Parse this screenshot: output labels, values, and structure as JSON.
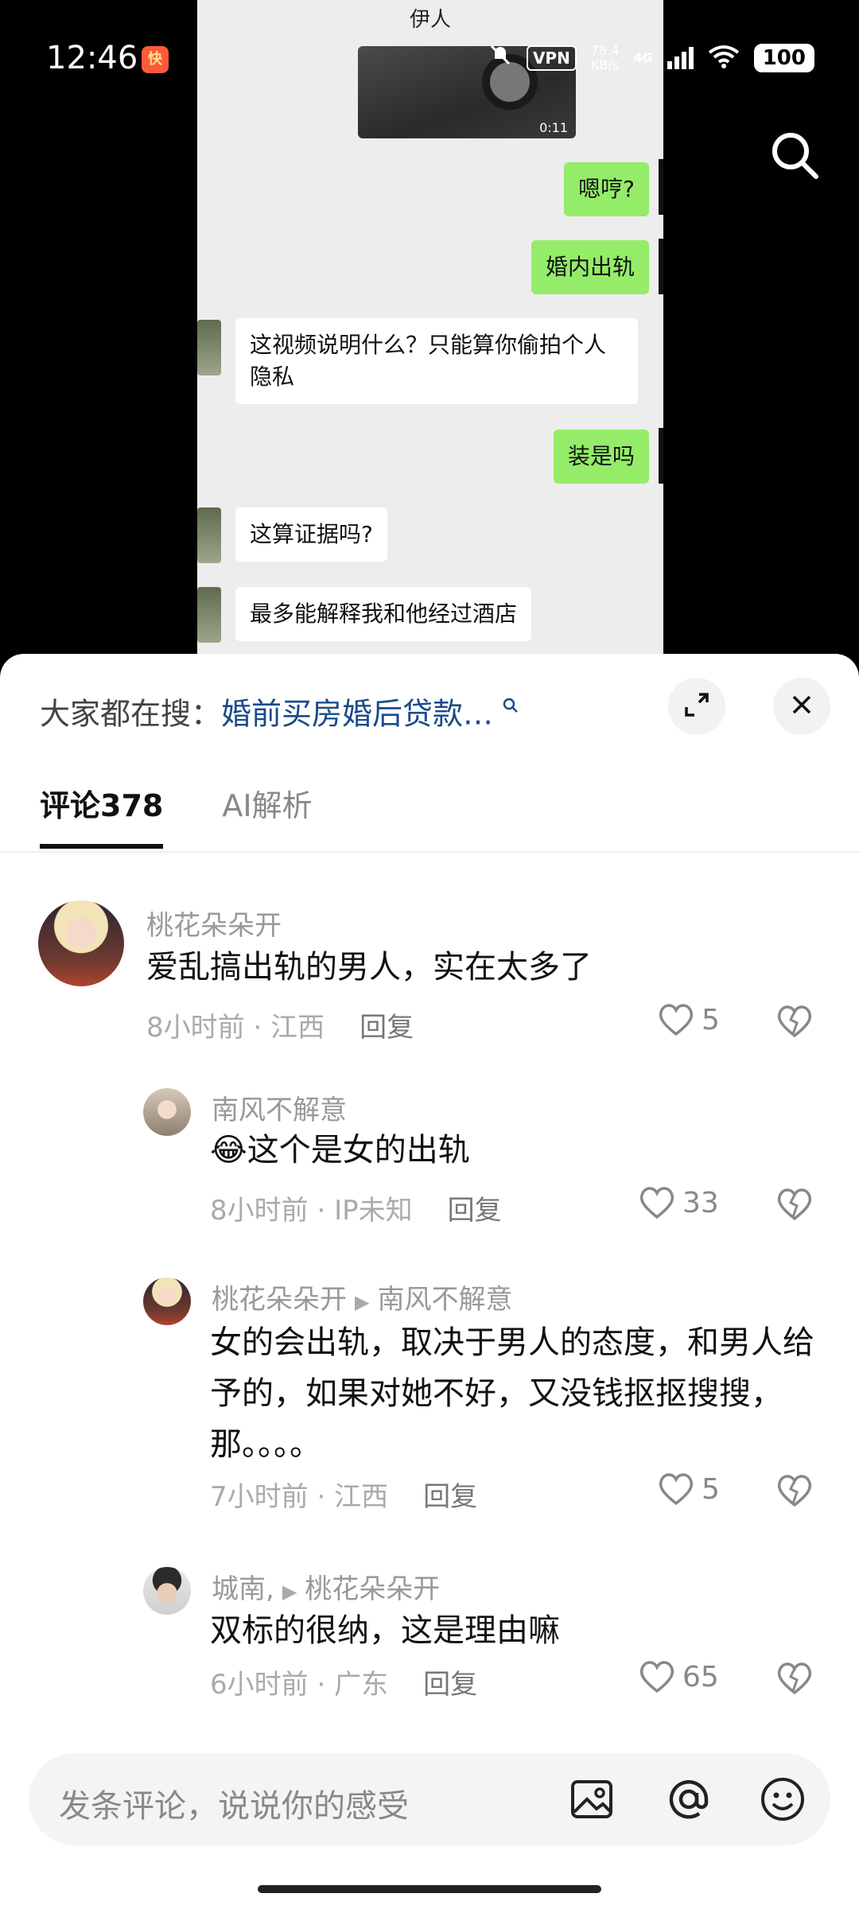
{
  "status_bar": {
    "time": "12:46",
    "app_icon_text": "快",
    "vpn": "VPN",
    "speed_value": "78.4",
    "speed_unit": "KB/s",
    "network": "4G",
    "battery": "100"
  },
  "video": {
    "chat_title": "伊人",
    "video_duration": "0:11",
    "messages": [
      {
        "side": "sent",
        "text": "嗯哼?"
      },
      {
        "side": "sent",
        "text": "婚内出轨"
      },
      {
        "side": "recv",
        "text": "这视频说明什么？只能算你偷拍个人隐私"
      },
      {
        "side": "sent",
        "text": "装是吗"
      },
      {
        "side": "recv",
        "text": "这算证据吗?"
      },
      {
        "side": "recv",
        "text": "最多能解释我和他经过酒店"
      }
    ]
  },
  "sheet": {
    "search_prefix": "大家都在搜：",
    "search_query": "婚前买房婚后贷款…",
    "tabs": [
      {
        "label": "评论378",
        "active": true
      },
      {
        "label": "AI解析",
        "active": false
      }
    ]
  },
  "comments": [
    {
      "user": "桃花朵朵开",
      "text": "爱乱搞出轨的男人，实在太多了",
      "time": "8小时前",
      "location": "江西",
      "reply": "回复",
      "likes": "5"
    },
    {
      "user": "南风不解意",
      "emoji": "😂",
      "text": "这个是女的出轨",
      "time": "8小时前",
      "location": "IP未知",
      "reply": "回复",
      "likes": "33"
    },
    {
      "user": "桃花朵朵开",
      "reply_to": "南风不解意",
      "text": "女的会出轨，取决于男人的态度，和男人给予的，如果对她不好，又没钱抠抠搜搜，那。。。。",
      "time": "7小时前",
      "location": "江西",
      "reply": "回复",
      "likes": "5"
    },
    {
      "user": "城南,",
      "reply_to": "桃花朵朵开",
      "text": "双标的很纳，这是理由嘛",
      "time": "6小时前",
      "location": "广东",
      "reply": "回复",
      "likes": "65"
    }
  ],
  "input": {
    "placeholder": "发条评论，说说你的感受"
  },
  "icons": [
    "search-icon",
    "expand-icon",
    "close-icon",
    "heart-icon",
    "broken-heart-icon",
    "image-icon",
    "at-icon",
    "emoji-icon"
  ]
}
